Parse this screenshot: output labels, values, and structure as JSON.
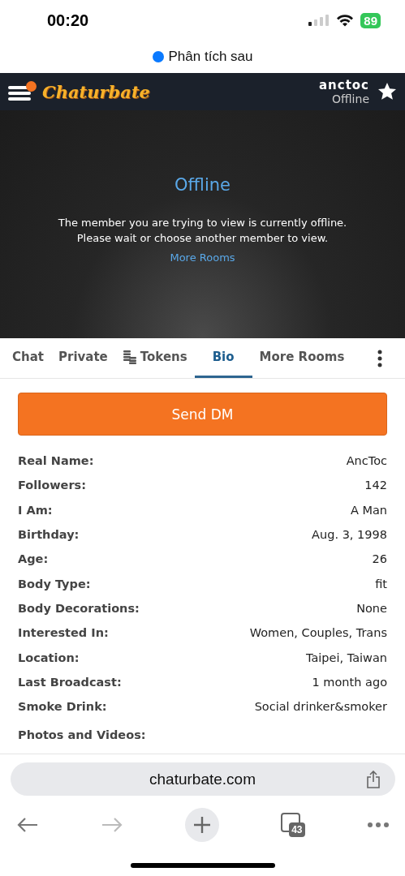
{
  "status_bar": {
    "time": "00:20",
    "battery": "89"
  },
  "notice": {
    "text": "Phân tích sau"
  },
  "header": {
    "logo": "Chaturbate",
    "menu_badge": true,
    "username": "anctoc",
    "status": "Offline"
  },
  "hero": {
    "title": "Offline",
    "message": "The member you are trying to view is currently offline. Please wait or choose another member to view.",
    "link": "More Rooms"
  },
  "tabs": [
    {
      "label": "Chat",
      "selected": false,
      "kind": "text"
    },
    {
      "label": "Private",
      "selected": false,
      "kind": "text"
    },
    {
      "label": "Tokens",
      "selected": false,
      "kind": "tokens"
    },
    {
      "label": "Bio",
      "selected": true,
      "kind": "text"
    },
    {
      "label": "More Rooms",
      "selected": false,
      "kind": "text"
    }
  ],
  "send_button": "Send DM",
  "bio": [
    {
      "label": "Real Name:",
      "value": "AncToc"
    },
    {
      "label": "Followers:",
      "value": "142"
    },
    {
      "label": "I Am:",
      "value": "A Man"
    },
    {
      "label": "Birthday:",
      "value": "Aug. 3, 1998"
    },
    {
      "label": "Age:",
      "value": "26"
    },
    {
      "label": "Body Type:",
      "value": "fit"
    },
    {
      "label": "Body Decorations:",
      "value": "None"
    },
    {
      "label": "Interested In:",
      "value": "Women, Couples, Trans"
    },
    {
      "label": "Location:",
      "value": "Taipei, Taiwan"
    },
    {
      "label": "Last Broadcast:",
      "value": "1 month ago"
    },
    {
      "label": "Smoke Drink:",
      "value": "Social drinker&smoker"
    }
  ],
  "section_heading": "Photos and Videos:",
  "browser": {
    "url": "chaturbate.com",
    "tab_count": "43",
    "back_disabled": false,
    "forward_disabled": true
  }
}
